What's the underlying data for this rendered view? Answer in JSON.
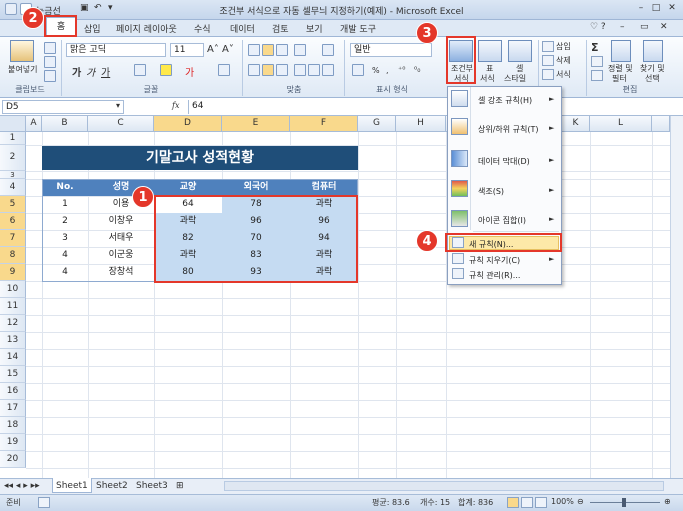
{
  "window": {
    "title": "조건부 서식으로 자동 셀무늬 지정하기(예제) - Microsoft Excel",
    "qat_font": "눈금선"
  },
  "tabs": [
    "홈",
    "삽입",
    "페이지 레이아웃",
    "수식",
    "데이터",
    "검토",
    "보기",
    "개발 도구"
  ],
  "ribbon": {
    "paste_label": "붙여넣기",
    "font_name": "맑은 고딕",
    "font_size": "11",
    "number_format": "일반",
    "conditional_format_label": "조건부\n서식",
    "cf_line1": "조건부",
    "cf_line2": "서식",
    "table_line1": "표",
    "table_line2": "서식",
    "cellstyle_line1": "셀",
    "cellstyle_line2": "스타일",
    "insert_label": "삽입",
    "delete_label": "삭제",
    "format_label": "서식",
    "sort_label1": "정렬 및",
    "sort_label2": "필터",
    "find_label1": "찾기 및",
    "find_label2": "선택",
    "groups": {
      "clipboard": "클립보드",
      "font": "글꼴",
      "alignment": "맞춤",
      "number": "표시 형식",
      "edit": "편집"
    }
  },
  "formula": {
    "name_box": "D5",
    "fx": "fx",
    "value": "64"
  },
  "columns": [
    "A",
    "B",
    "C",
    "D",
    "E",
    "F",
    "G",
    "H",
    "K",
    "L"
  ],
  "rows": [
    "1",
    "2",
    "3",
    "4",
    "5",
    "6",
    "7",
    "8",
    "9",
    "10",
    "11",
    "12",
    "13",
    "14",
    "15",
    "16",
    "17",
    "18",
    "19",
    "20"
  ],
  "sheet": {
    "title": "기말고사 성적현황",
    "headers": [
      "No.",
      "성명",
      "교양",
      "외국어",
      "컴퓨터"
    ],
    "data": [
      [
        "1",
        "이용",
        "64",
        "78",
        "과락"
      ],
      [
        "2",
        "이창우",
        "과락",
        "96",
        "96"
      ],
      [
        "3",
        "서태우",
        "82",
        "70",
        "94"
      ],
      [
        "4",
        "이군웅",
        "과락",
        "83",
        "과락"
      ],
      [
        "4",
        "장창석",
        "80",
        "93",
        "과락"
      ]
    ]
  },
  "menu": {
    "items": [
      {
        "label": "셀 강조 규칙(H)",
        "has_submenu": true
      },
      {
        "label": "상위/하위 규칙(T)",
        "has_submenu": true
      },
      {
        "label": "데이터 막대(D)",
        "has_submenu": true
      },
      {
        "label": "색조(S)",
        "has_submenu": true
      },
      {
        "label": "아이콘 집합(I)",
        "has_submenu": true
      }
    ],
    "small_items": [
      {
        "label": "새 규칙(N)...",
        "has_submenu": false
      },
      {
        "label": "규칙 지우기(C)",
        "has_submenu": true
      },
      {
        "label": "규칙 관리(R)...",
        "has_submenu": false
      }
    ]
  },
  "callouts": [
    "1",
    "2",
    "3",
    "4"
  ],
  "sheet_tabs": [
    "Sheet1",
    "Sheet2",
    "Sheet3"
  ],
  "status": {
    "mode": "준비",
    "average": "평균: 83.6",
    "count": "개수: 15",
    "sum": "합계: 836",
    "zoom": "100%"
  },
  "colors": {
    "accent_red": "#e4372a",
    "header_blue": "#4f81bd",
    "title_navy": "#1f4e79",
    "selection": "#c5dbf2"
  }
}
